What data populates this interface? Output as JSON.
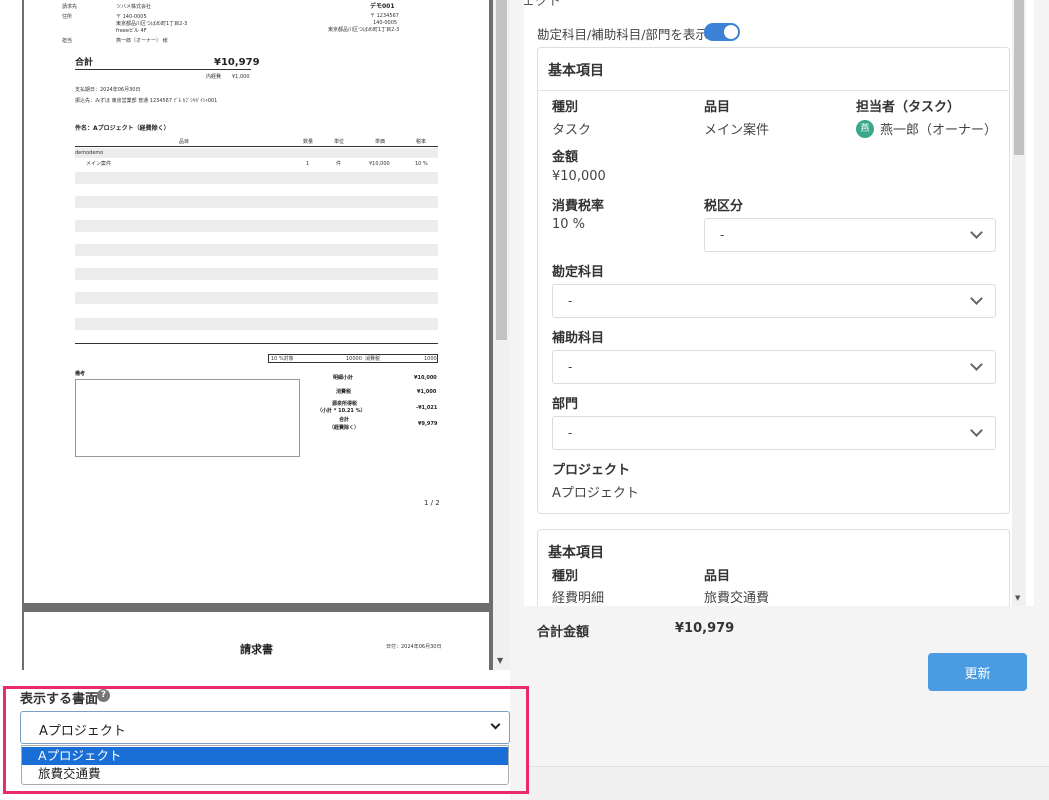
{
  "preview": {
    "page1": {
      "recipient_label": "請求先",
      "recipient_name": "ツバメ株式会社",
      "address_label": "住所",
      "address_postal": "〒 140-0005",
      "address_line1": "東京都品川区つばめ町1丁目2-3",
      "address_line2": "freeeビル 4F",
      "contact_label": "担当",
      "contact_name": "燕一郎（オーナー） 様",
      "issuer_name": "デモ001",
      "issuer_postal": "〒 1234567",
      "issuer_code": "140-0005",
      "issuer_address": "東京都品川区つばめ町1丁目2-3",
      "total_label": "合計",
      "total_value": "¥10,979",
      "expense_label": "内経費",
      "expense_value": "¥1,000",
      "due_date": "支払期日：2024年06月30日",
      "bank": "振込先：みずほ 東京営業部 普通 1234567 ﾃﾞﾓ ｶﾌﾞｼｷｶﾞｲｼｬ001",
      "subject": "件名：Aプロジェクト（経費除く）",
      "col_item": "品目",
      "col_qty": "数量",
      "col_unit": "単位",
      "col_price": "単価",
      "col_tax": "税率",
      "group_row": "demodemo",
      "line_item": "メイン案件",
      "line_qty": "1",
      "line_unit": "件",
      "line_price": "¥10,000",
      "line_tax": "10 %",
      "tax_target_label": "10 %対象",
      "tax_target_value": "10000",
      "tax_label": "消費税",
      "tax_value": "1000",
      "notes_label": "備考",
      "subtotal_label": "明細小計",
      "subtotal_value": "¥10,000",
      "consumption_tax_label": "消費税",
      "consumption_tax_value": "¥1,000",
      "withholding_label_1": "源泉所得税",
      "withholding_label_2": "（小計 * 10.21 %）",
      "withholding_value": "-¥1,021",
      "grand_label_1": "合計",
      "grand_label_2": "（経費除く）",
      "grand_value": "¥9,979",
      "page_number": "1 / 2"
    },
    "page2": {
      "title": "請求書",
      "date": "日付：2024年06月30日"
    }
  },
  "panel": {
    "header_title_partial": "Aプロジェクト",
    "toggle_label": "勘定科目/補助科目/部門を表示",
    "toggle_on": true,
    "accent_color": "#3b82d6",
    "card1": {
      "title": "基本項目",
      "type_label": "種別",
      "type_value": "タスク",
      "item_label": "品目",
      "item_value": "メイン案件",
      "assignee_label": "担当者（タスク）",
      "assignee_avatar": "燕",
      "assignee_value": "燕一郎（オーナー）",
      "amount_label": "金額",
      "amount_value": "¥10,000",
      "tax_rate_label": "消費税率",
      "tax_rate_value": "10 %",
      "tax_class_label": "税区分",
      "tax_class_value": "-",
      "account_label": "勘定科目",
      "account_value": "-",
      "sub_account_label": "補助科目",
      "sub_account_value": "-",
      "department_label": "部門",
      "department_value": "-",
      "project_label": "プロジェクト",
      "project_value": "Aプロジェクト"
    },
    "card2": {
      "title": "基本項目",
      "type_label": "種別",
      "type_value": "経費明細",
      "item_label": "品目",
      "item_value": "旅費交通費"
    },
    "total_label": "合計金額",
    "total_value": "¥10,979",
    "update_button": "更新"
  },
  "doc_select": {
    "label": "表示する書面",
    "help_icon": "?",
    "selected": "Aプロジェクト",
    "options": [
      "Aプロジェクト",
      "旅費交通費"
    ],
    "highlight_color": "#ea2a6e"
  }
}
